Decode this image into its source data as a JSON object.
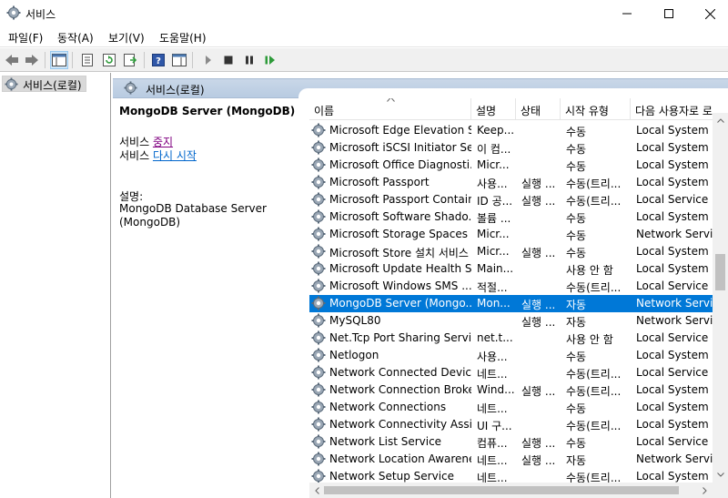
{
  "window": {
    "title": "서비스",
    "icon": "gear-icon"
  },
  "menu": [
    "파일(F)",
    "동작(A)",
    "보기(V)",
    "도움말(H)"
  ],
  "toolbar": {
    "icons": [
      "back-arrow-icon",
      "forward-arrow-icon",
      "console-tree-icon",
      "properties-icon",
      "refresh-icon",
      "export-list-icon",
      "help-icon",
      "action-pane-icon",
      "start-service-icon",
      "stop-service-icon",
      "pause-service-icon",
      "restart-service-icon"
    ]
  },
  "tree": {
    "item_label": "서비스(로컬)"
  },
  "pane": {
    "header": "서비스(로컬)",
    "service_title": "MongoDB Server (MongoDB)",
    "stop_prefix": "서비스 ",
    "stop_link": "중지",
    "restart_prefix": "서비스 ",
    "restart_link": "다시 시작",
    "desc_label": "설명:",
    "desc_line1": "MongoDB Database Server",
    "desc_line2": "(MongoDB)"
  },
  "table": {
    "columns": [
      "이름",
      "설명",
      "상태",
      "시작 유형",
      "다음 사용자로 로"
    ],
    "rows": [
      {
        "name": "Microsoft Edge Elevation S...",
        "desc": "Keep...",
        "status": "",
        "startup": "수동",
        "logon": "Local System"
      },
      {
        "name": "Microsoft iSCSI Initiator Se...",
        "desc": "이 컴...",
        "status": "",
        "startup": "수동",
        "logon": "Local System"
      },
      {
        "name": "Microsoft Office Diagnosti...",
        "desc": "Micr...",
        "status": "",
        "startup": "수동",
        "logon": "Local System"
      },
      {
        "name": "Microsoft Passport",
        "desc": "사용...",
        "status": "실행 ...",
        "startup": "수동(트리...",
        "logon": "Local System"
      },
      {
        "name": "Microsoft Passport Container",
        "desc": "ID 공...",
        "status": "실행 ...",
        "startup": "수동(트리...",
        "logon": "Local Service"
      },
      {
        "name": "Microsoft Software Shado...",
        "desc": "볼륨 ...",
        "status": "",
        "startup": "수동",
        "logon": "Local System"
      },
      {
        "name": "Microsoft Storage Spaces ...",
        "desc": "Micr...",
        "status": "",
        "startup": "수동",
        "logon": "Network Service"
      },
      {
        "name": "Microsoft Store 설치 서비스",
        "desc": "Micr...",
        "status": "실행 ...",
        "startup": "수동",
        "logon": "Local System"
      },
      {
        "name": "Microsoft Update Health S...",
        "desc": "Main...",
        "status": "",
        "startup": "사용 안 함",
        "logon": "Local System"
      },
      {
        "name": "Microsoft Windows SMS ...",
        "desc": "적절...",
        "status": "",
        "startup": "수동(트리...",
        "logon": "Local Service"
      },
      {
        "name": "MongoDB Server (Mongo...",
        "desc": "Mon...",
        "status": "실행 ...",
        "startup": "자동",
        "logon": "Network Service",
        "selected": true
      },
      {
        "name": "MySQL80",
        "desc": "",
        "status": "실행 ...",
        "startup": "자동",
        "logon": "Network Service"
      },
      {
        "name": "Net.Tcp Port Sharing Service",
        "desc": "net.t...",
        "status": "",
        "startup": "사용 안 함",
        "logon": "Local Service"
      },
      {
        "name": "Netlogon",
        "desc": "사용...",
        "status": "",
        "startup": "수동",
        "logon": "Local System"
      },
      {
        "name": "Network Connected Device...",
        "desc": "네트...",
        "status": "",
        "startup": "수동(트리...",
        "logon": "Local Service"
      },
      {
        "name": "Network Connection Broker",
        "desc": "Wind...",
        "status": "실행 ...",
        "startup": "수동(트리...",
        "logon": "Local System"
      },
      {
        "name": "Network Connections",
        "desc": "네트...",
        "status": "",
        "startup": "수동",
        "logon": "Local System"
      },
      {
        "name": "Network Connectivity Assis...",
        "desc": "UI 구...",
        "status": "",
        "startup": "수동(트리...",
        "logon": "Local System"
      },
      {
        "name": "Network List Service",
        "desc": "컴퓨...",
        "status": "실행 ...",
        "startup": "수동",
        "logon": "Local Service"
      },
      {
        "name": "Network Location Awareness",
        "desc": "네트...",
        "status": "실행 ...",
        "startup": "자동",
        "logon": "Network Service"
      },
      {
        "name": "Network Setup Service",
        "desc": "네트...",
        "status": "",
        "startup": "수동(트리...",
        "logon": "Local System"
      }
    ]
  },
  "colors": {
    "selected_row": "#0078d7",
    "header_band": "#c4d4e8",
    "link": "#0066cc",
    "visited_link": "#800080"
  }
}
